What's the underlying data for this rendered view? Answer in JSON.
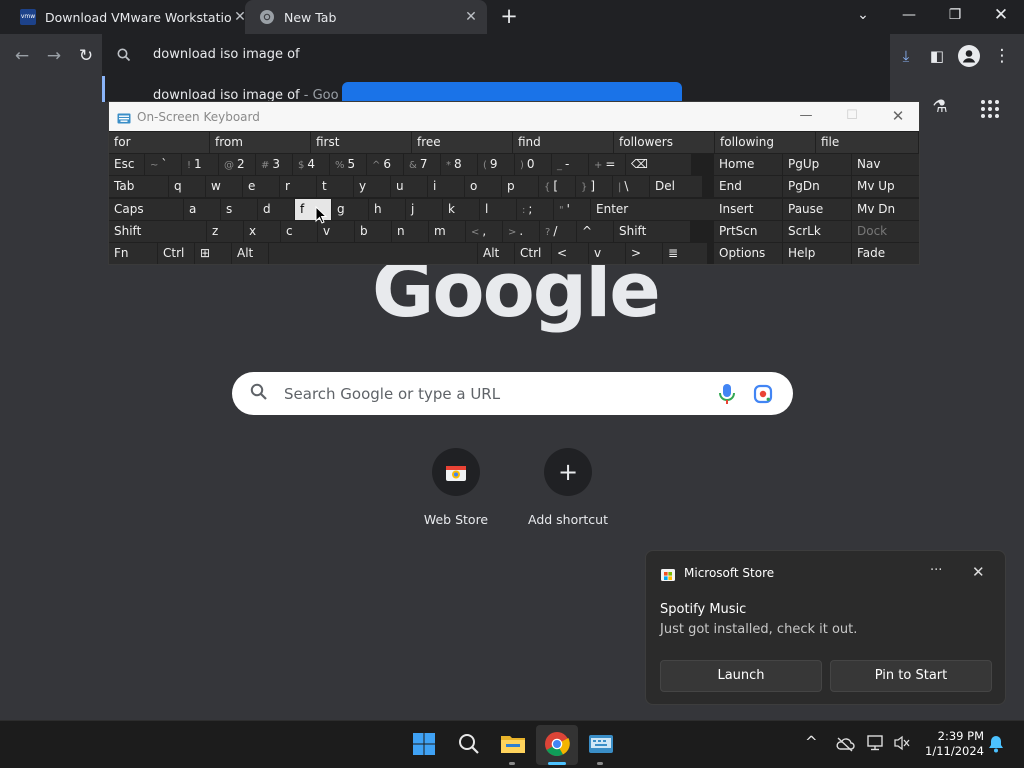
{
  "browser": {
    "tabs": [
      {
        "title": "Download VMware Workstation P",
        "favicon": "vmware-icon"
      },
      {
        "title": "New Tab",
        "favicon": "chrome-icon"
      }
    ],
    "new_tab_symbol": "+",
    "omnibox_text": "download iso image of",
    "suggestion_main": "download iso image of",
    "suggestion_suffix": " - Goo"
  },
  "page": {
    "logo_text": "Google",
    "search_placeholder": "Search Google or type a URL",
    "shortcuts": [
      {
        "label": "Web Store"
      },
      {
        "label": "Add shortcut",
        "symbol": "+"
      }
    ]
  },
  "osk": {
    "title": "On-Screen Keyboard",
    "predictions": [
      "for",
      "from",
      "first",
      "free",
      "find",
      "followers",
      "following",
      "file"
    ],
    "rows": [
      [
        {
          "m": "Esc"
        },
        {
          "s": "~",
          "m": "`"
        },
        {
          "s": "!",
          "m": "1"
        },
        {
          "s": "@",
          "m": "2"
        },
        {
          "s": "#",
          "m": "3"
        },
        {
          "s": "$",
          "m": "4"
        },
        {
          "s": "%",
          "m": "5"
        },
        {
          "s": "^",
          "m": "6"
        },
        {
          "s": "&",
          "m": "7"
        },
        {
          "s": "*",
          "m": "8"
        },
        {
          "s": "(",
          "m": "9"
        },
        {
          "s": ")",
          "m": "0"
        },
        {
          "s": "_",
          "m": "-"
        },
        {
          "s": "+",
          "m": "="
        },
        {
          "m": "⌫"
        }
      ],
      [
        {
          "m": "Tab"
        },
        {
          "m": "q"
        },
        {
          "m": "w"
        },
        {
          "m": "e"
        },
        {
          "m": "r"
        },
        {
          "m": "t"
        },
        {
          "m": "y"
        },
        {
          "m": "u"
        },
        {
          "m": "i"
        },
        {
          "m": "o"
        },
        {
          "m": "p"
        },
        {
          "s": "{",
          "m": "["
        },
        {
          "s": "}",
          "m": "]"
        },
        {
          "s": "|",
          "m": "\\"
        },
        {
          "m": "Del"
        }
      ],
      [
        {
          "m": "Caps"
        },
        {
          "m": "a"
        },
        {
          "m": "s"
        },
        {
          "m": "d"
        },
        {
          "m": "f"
        },
        {
          "m": "g"
        },
        {
          "m": "h"
        },
        {
          "m": "j"
        },
        {
          "m": "k"
        },
        {
          "m": "l"
        },
        {
          "s": ":",
          "m": ";"
        },
        {
          "s": "\"",
          "m": "'"
        },
        {
          "m": "Enter"
        }
      ],
      [
        {
          "m": "Shift"
        },
        {
          "m": "z"
        },
        {
          "m": "x"
        },
        {
          "m": "c"
        },
        {
          "m": "v"
        },
        {
          "m": "b"
        },
        {
          "m": "n"
        },
        {
          "m": "m"
        },
        {
          "s": "<",
          "m": ","
        },
        {
          "s": ">",
          "m": "."
        },
        {
          "s": "?",
          "m": "/"
        },
        {
          "m": "^"
        },
        {
          "m": "Shift"
        }
      ],
      [
        {
          "m": "Fn"
        },
        {
          "m": "Ctrl"
        },
        {
          "m": "⊞"
        },
        {
          "m": "Alt"
        },
        {
          "m": ""
        },
        {
          "m": "Alt"
        },
        {
          "m": "Ctrl"
        },
        {
          "m": "<"
        },
        {
          "m": "v"
        },
        {
          "m": ">"
        },
        {
          "m": "≣"
        }
      ]
    ],
    "nav_rows": [
      [
        "Home",
        "PgUp",
        "Nav"
      ],
      [
        "End",
        "PgDn",
        "Mv Up"
      ],
      [
        "Insert",
        "Pause",
        "Mv Dn"
      ],
      [
        "PrtScn",
        "ScrLk",
        "Dock"
      ],
      [
        "Options",
        "Help",
        "Fade"
      ]
    ]
  },
  "notification": {
    "app": "Microsoft Store",
    "title": "Spotify Music",
    "body": "Just got installed, check it out.",
    "more_symbol": "···",
    "buttons": [
      "Launch",
      "Pin to Start"
    ]
  },
  "taskbar": {
    "time": "2:39 PM",
    "date": "1/11/2024",
    "tray_chevron": "^"
  }
}
